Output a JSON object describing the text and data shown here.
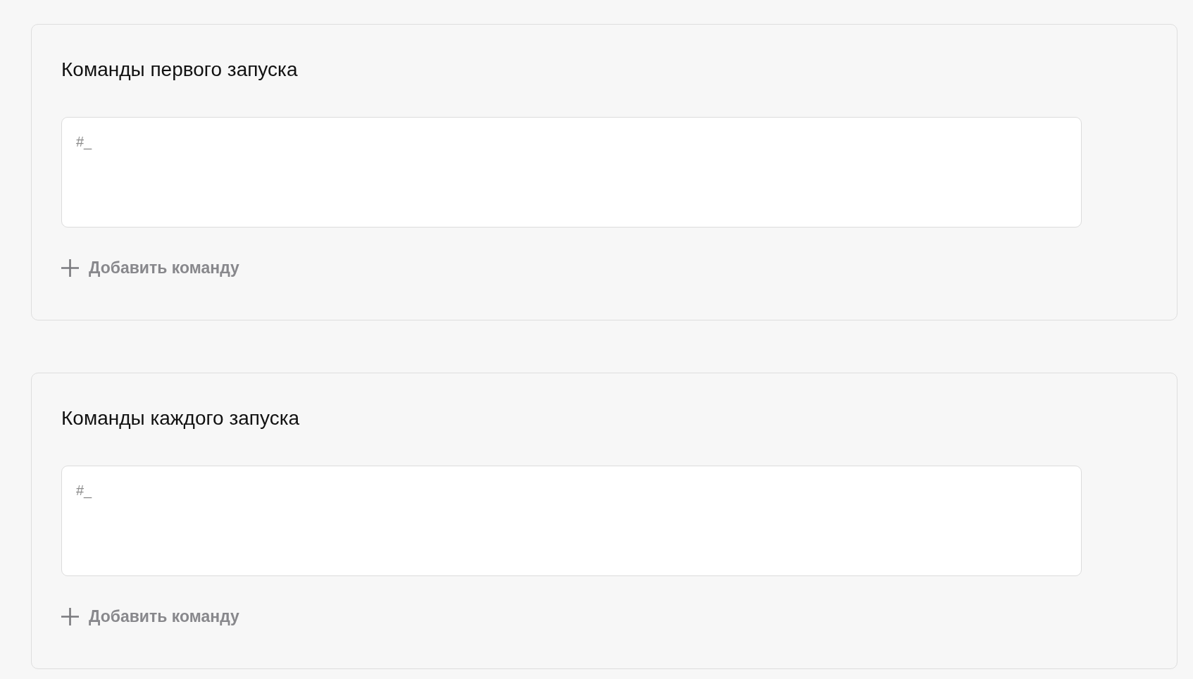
{
  "sections": [
    {
      "title": "Команды первого запуска",
      "field": {
        "placeholder": "#_"
      },
      "add_button": {
        "label": "Добавить команду"
      }
    },
    {
      "title": "Команды каждого запуска",
      "field": {
        "placeholder": "#_"
      },
      "add_button": {
        "label": "Добавить команду"
      }
    }
  ]
}
